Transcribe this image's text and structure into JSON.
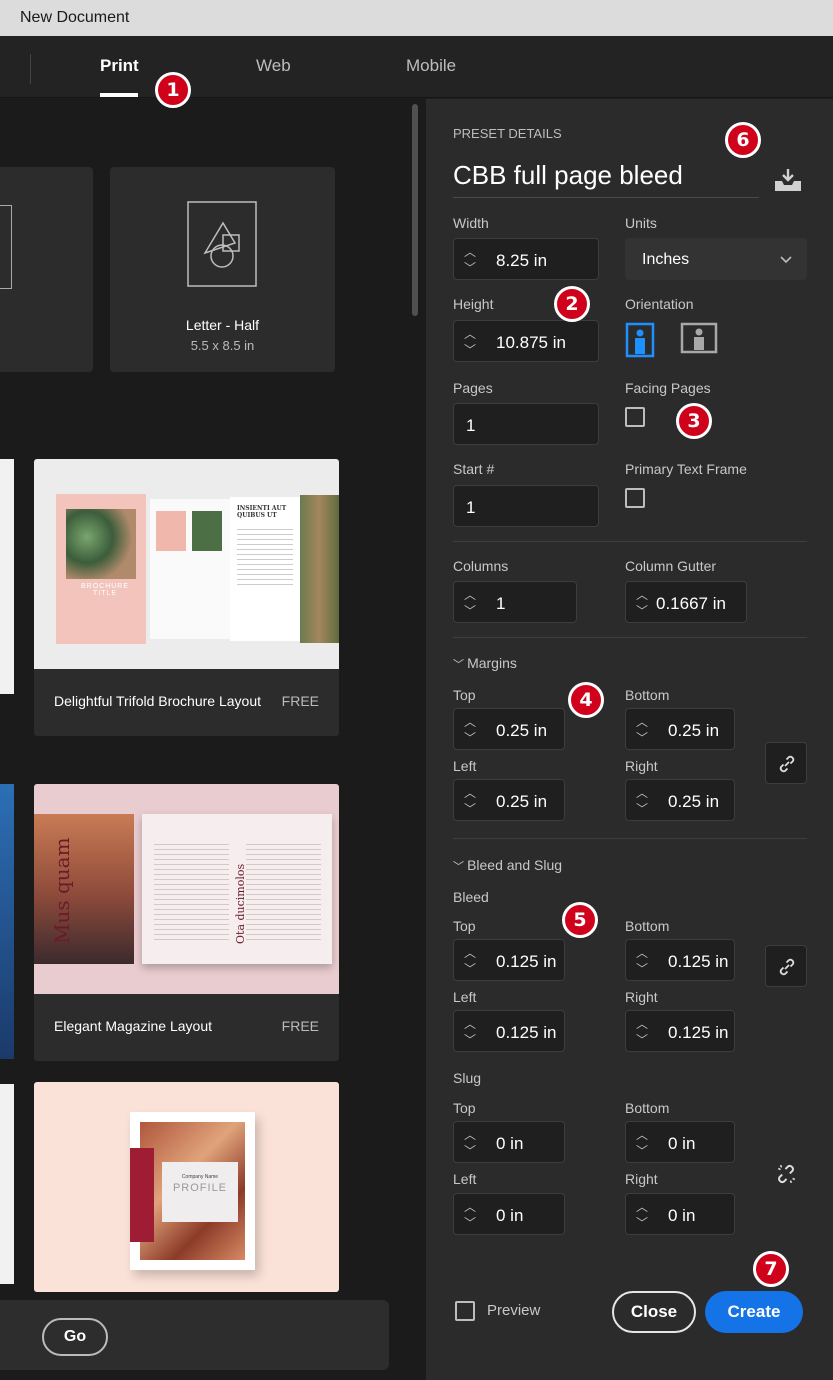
{
  "window": {
    "title": "New Document"
  },
  "tabs": [
    {
      "label": "Print",
      "active": true
    },
    {
      "label": "Web",
      "active": false
    },
    {
      "label": "Mobile",
      "active": false
    }
  ],
  "badges": [
    "1",
    "2",
    "3",
    "4",
    "5",
    "6",
    "7"
  ],
  "presets": {
    "letter_half": {
      "title": "Letter - Half",
      "size": "5.5 x 8.5 in"
    }
  },
  "templates": [
    {
      "title": "Delightful Trifold Brochure Layout",
      "price": "FREE",
      "thumb_text": {
        "heading": "INSIENTI AUT QUIBUS UT",
        "cover": "BROCHURE TITLE"
      }
    },
    {
      "title": "Elegant Magazine Layout",
      "price": "FREE",
      "thumb_text": {
        "cover": "Mus quam",
        "spine": "Ota ducimolos"
      }
    },
    {
      "title": "",
      "price": "",
      "thumb_text": {
        "company": "Company Name",
        "cover": "PROFILE"
      }
    }
  ],
  "go_button": "Go",
  "preset_details": {
    "header": "PRESET DETAILS",
    "name": "CBB full page bleed",
    "width_label": "Width",
    "width": "8.25 in",
    "units_label": "Units",
    "units": "Inches",
    "height_label": "Height",
    "height": "10.875 in",
    "orientation_label": "Orientation",
    "orientation": "portrait",
    "pages_label": "Pages",
    "pages": "1",
    "facing_label": "Facing Pages",
    "facing_checked": false,
    "start_label": "Start #",
    "start": "1",
    "primary_label": "Primary Text Frame",
    "primary_checked": false,
    "columns_label": "Columns",
    "columns": "1",
    "gutter_label": "Column Gutter",
    "gutter": "0.1667 in"
  },
  "margins": {
    "section": "Margins",
    "top_label": "Top",
    "top": "0.25 in",
    "bottom_label": "Bottom",
    "bottom": "0.25 in",
    "left_label": "Left",
    "left": "0.25 in",
    "right_label": "Right",
    "right": "0.25 in"
  },
  "bleed_slug": {
    "section": "Bleed and Slug",
    "bleed_label": "Bleed",
    "bleed": {
      "top_label": "Top",
      "top": "0.125 in",
      "bottom_label": "Bottom",
      "bottom": "0.125 in",
      "left_label": "Left",
      "left": "0.125 in",
      "right_label": "Right",
      "right": "0.125 in"
    },
    "slug_label": "Slug",
    "slug": {
      "top_label": "Top",
      "top": "0 in",
      "bottom_label": "Bottom",
      "bottom": "0 in",
      "left_label": "Left",
      "left": "0 in",
      "right_label": "Right",
      "right": "0 in"
    }
  },
  "footer": {
    "preview_label": "Preview",
    "close": "Close",
    "create": "Create"
  },
  "colors": {
    "accent": "#1473e6",
    "badge": "#d0021b",
    "panel": "#2b2b2b"
  }
}
